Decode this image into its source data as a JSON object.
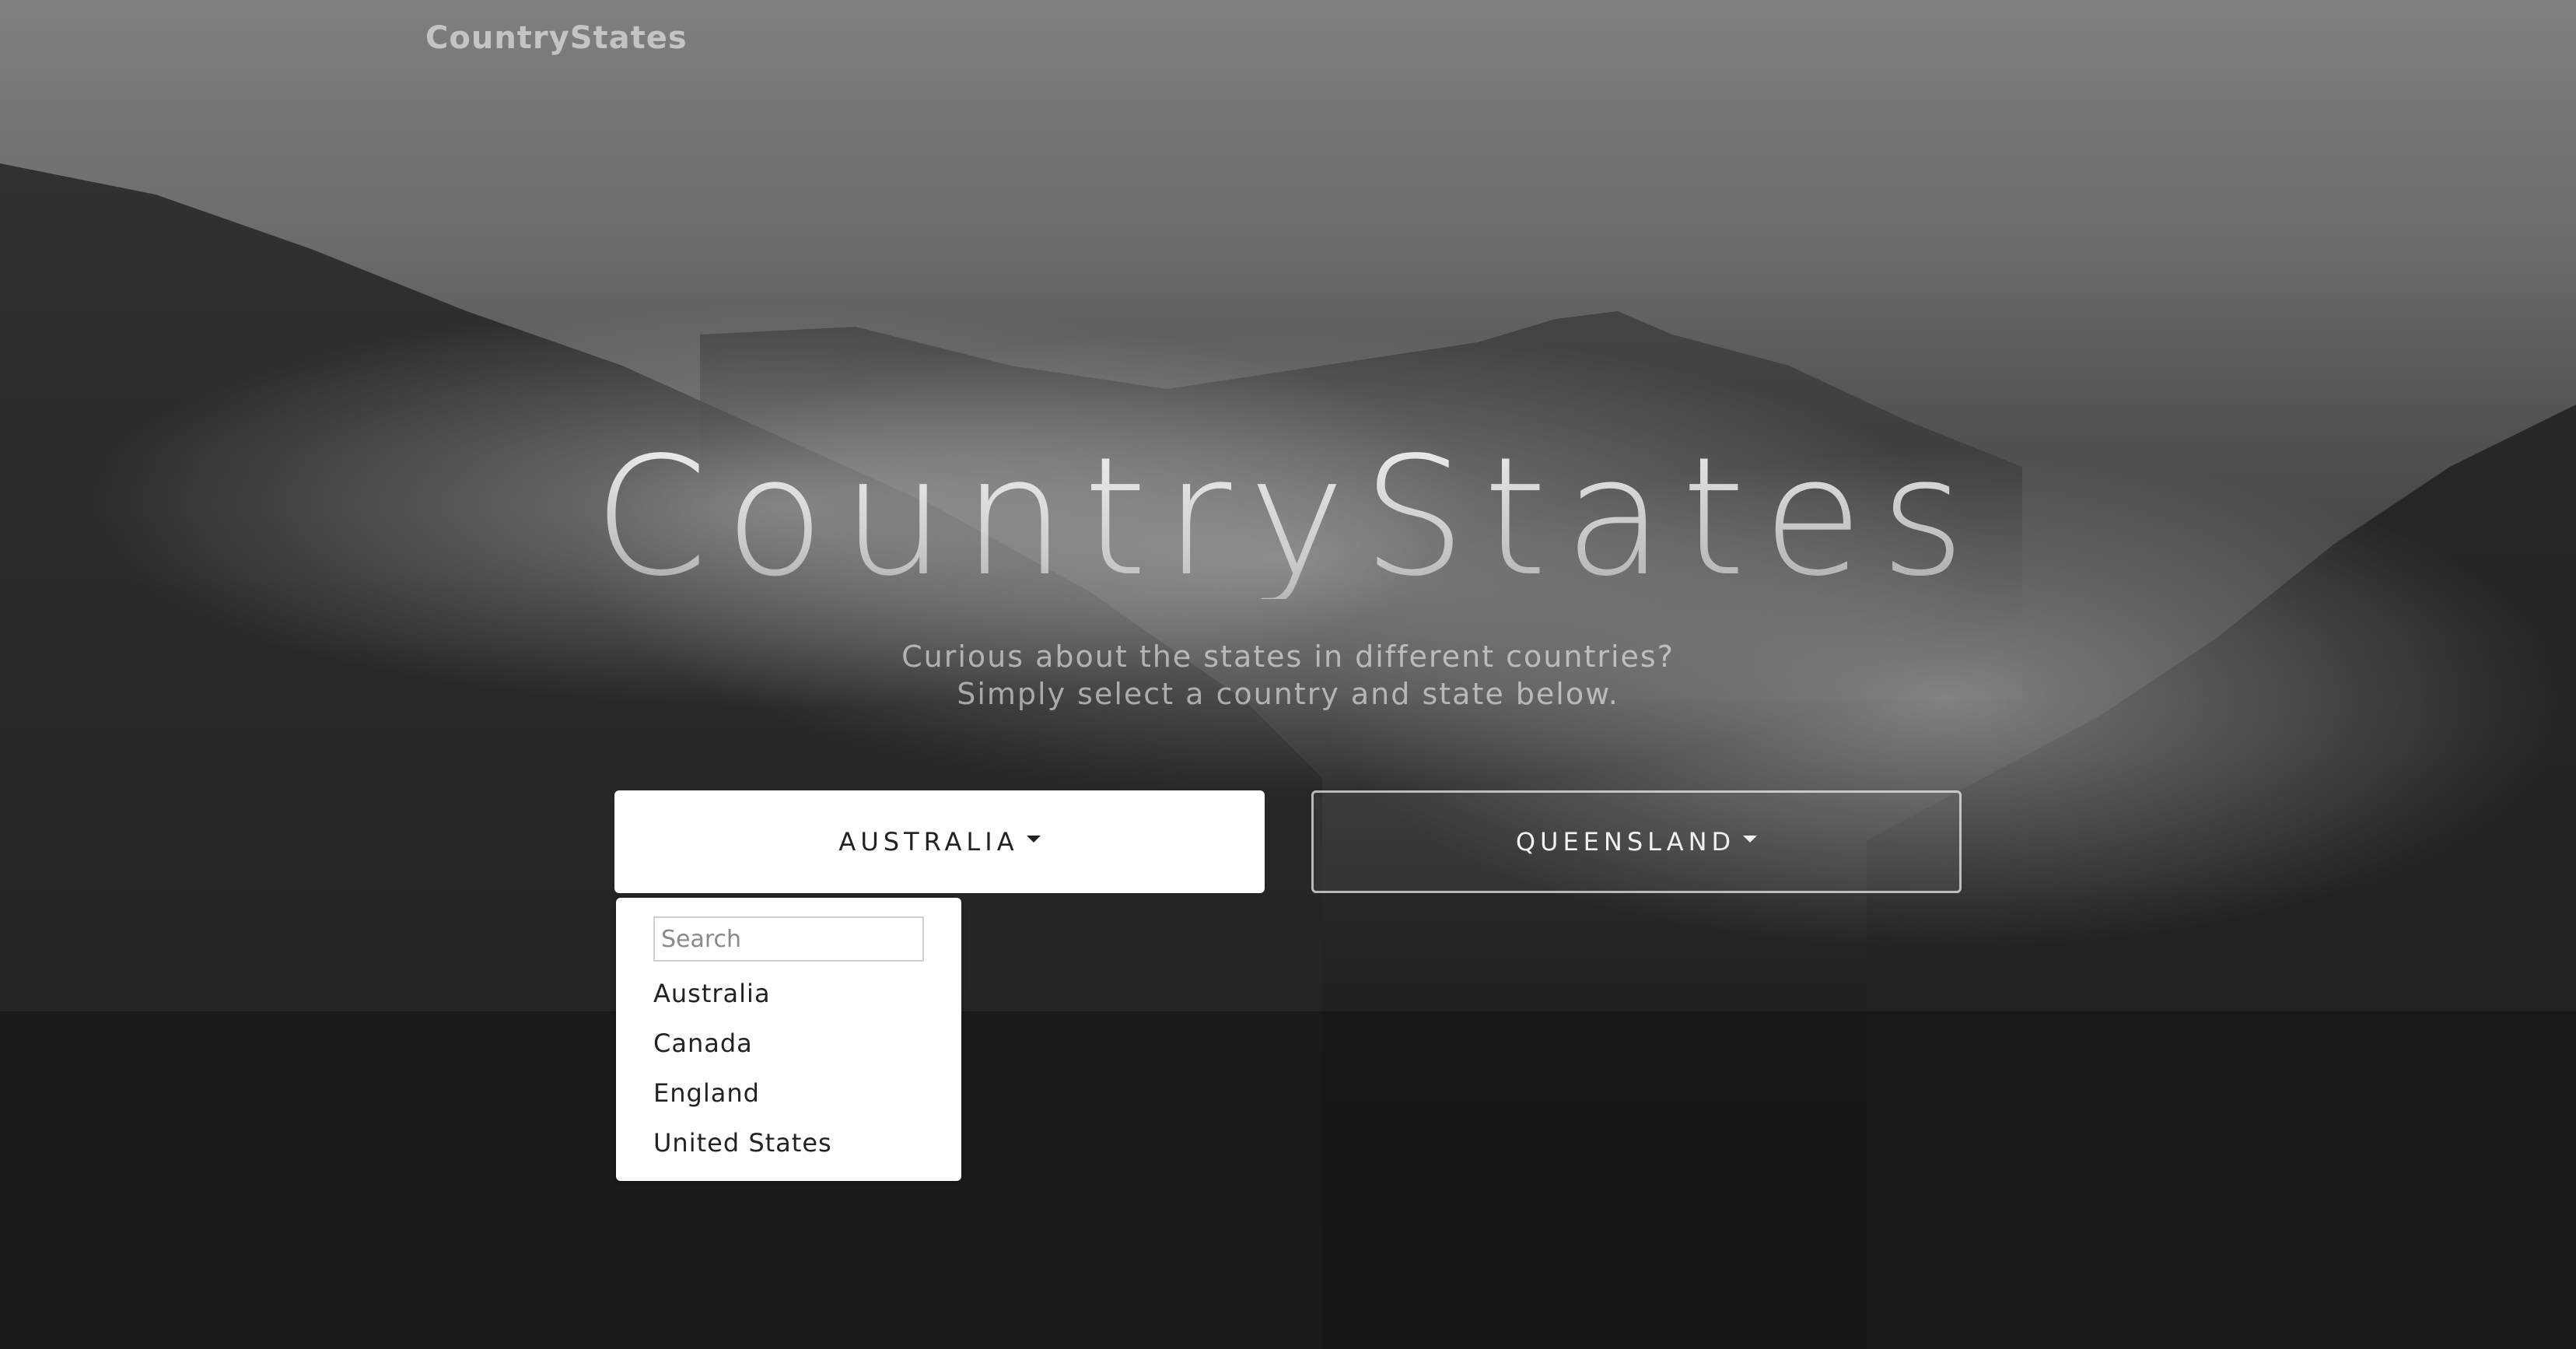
{
  "navbar": {
    "brand": "CountryStates"
  },
  "hero": {
    "title": "CountryStates",
    "subtitle_line1": "Curious about the states in different countries?",
    "subtitle_line2": "Simply select a country and state below."
  },
  "country_dropdown": {
    "selected": "AUSTRALIA",
    "search_placeholder": "Search",
    "options": [
      "Australia",
      "Canada",
      "England",
      "United States"
    ]
  },
  "state_dropdown": {
    "selected": "QUEENSLAND"
  },
  "colors": {
    "background_top": "#7f7f7f",
    "background_bottom": "#151515",
    "button_primary_bg": "#ffffff",
    "text_dark": "#222222"
  }
}
